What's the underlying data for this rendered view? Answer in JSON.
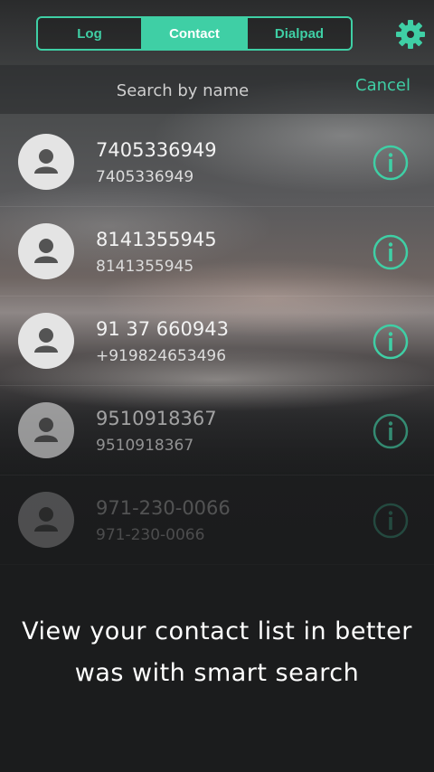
{
  "tabs": [
    {
      "label": "Log",
      "active": false
    },
    {
      "label": "Contact",
      "active": true
    },
    {
      "label": "Dialpad",
      "active": false
    }
  ],
  "settings_icon": "gear-icon",
  "search": {
    "placeholder": "Search by name",
    "cancel_label": "Cancel"
  },
  "contacts": [
    {
      "name": "7405336949",
      "number": "7405336949"
    },
    {
      "name": "8141355945",
      "number": "8141355945"
    },
    {
      "name": "91 37 660943",
      "number": "+919824653496"
    },
    {
      "name": "9510918367",
      "number": "9510918367"
    },
    {
      "name": "971-230-0066",
      "number": "971-230-0066"
    }
  ],
  "caption": {
    "line1": "View your contact list in better",
    "line2": "was with smart search"
  },
  "colors": {
    "accent": "#3fcfa5",
    "background": "#1b1c1d"
  }
}
